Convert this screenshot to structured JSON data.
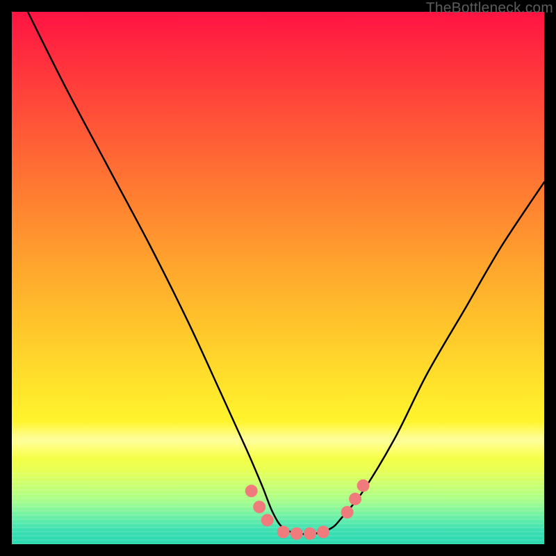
{
  "watermark": "TheBottleneck.com",
  "colors": {
    "marker": "#ef7b7d",
    "curve": "#000000"
  },
  "chart_data": {
    "type": "line",
    "title": "",
    "xlabel": "",
    "ylabel": "",
    "xlim": [
      0,
      100
    ],
    "ylim": [
      0,
      100
    ],
    "grid": false,
    "legend": false,
    "series": [
      {
        "name": "bottleneck-curve",
        "x": [
          3,
          10,
          18,
          26,
          33,
          39,
          44,
          47,
          49,
          51,
          54,
          57,
          60,
          62,
          66,
          72,
          78,
          85,
          92,
          100
        ],
        "y": [
          100,
          86,
          71,
          56,
          42,
          29,
          18,
          11,
          6,
          3,
          2,
          2,
          3,
          5,
          10,
          20,
          32,
          44,
          56,
          68
        ]
      }
    ],
    "markers": [
      {
        "name": "left-cluster-top",
        "x": 45.0,
        "y": 10.0
      },
      {
        "name": "left-cluster-mid",
        "x": 46.5,
        "y": 7.0
      },
      {
        "name": "left-cluster-bottom",
        "x": 48.0,
        "y": 4.5
      },
      {
        "name": "valley-flat-1",
        "x": 51.0,
        "y": 2.3
      },
      {
        "name": "valley-flat-2",
        "x": 53.5,
        "y": 2.0
      },
      {
        "name": "valley-flat-3",
        "x": 56.0,
        "y": 2.0
      },
      {
        "name": "valley-flat-4",
        "x": 58.5,
        "y": 2.3
      },
      {
        "name": "right-cluster-bottom",
        "x": 63.0,
        "y": 6.0
      },
      {
        "name": "right-cluster-mid",
        "x": 64.5,
        "y": 8.5
      },
      {
        "name": "right-cluster-top",
        "x": 66.0,
        "y": 11.0
      }
    ]
  }
}
